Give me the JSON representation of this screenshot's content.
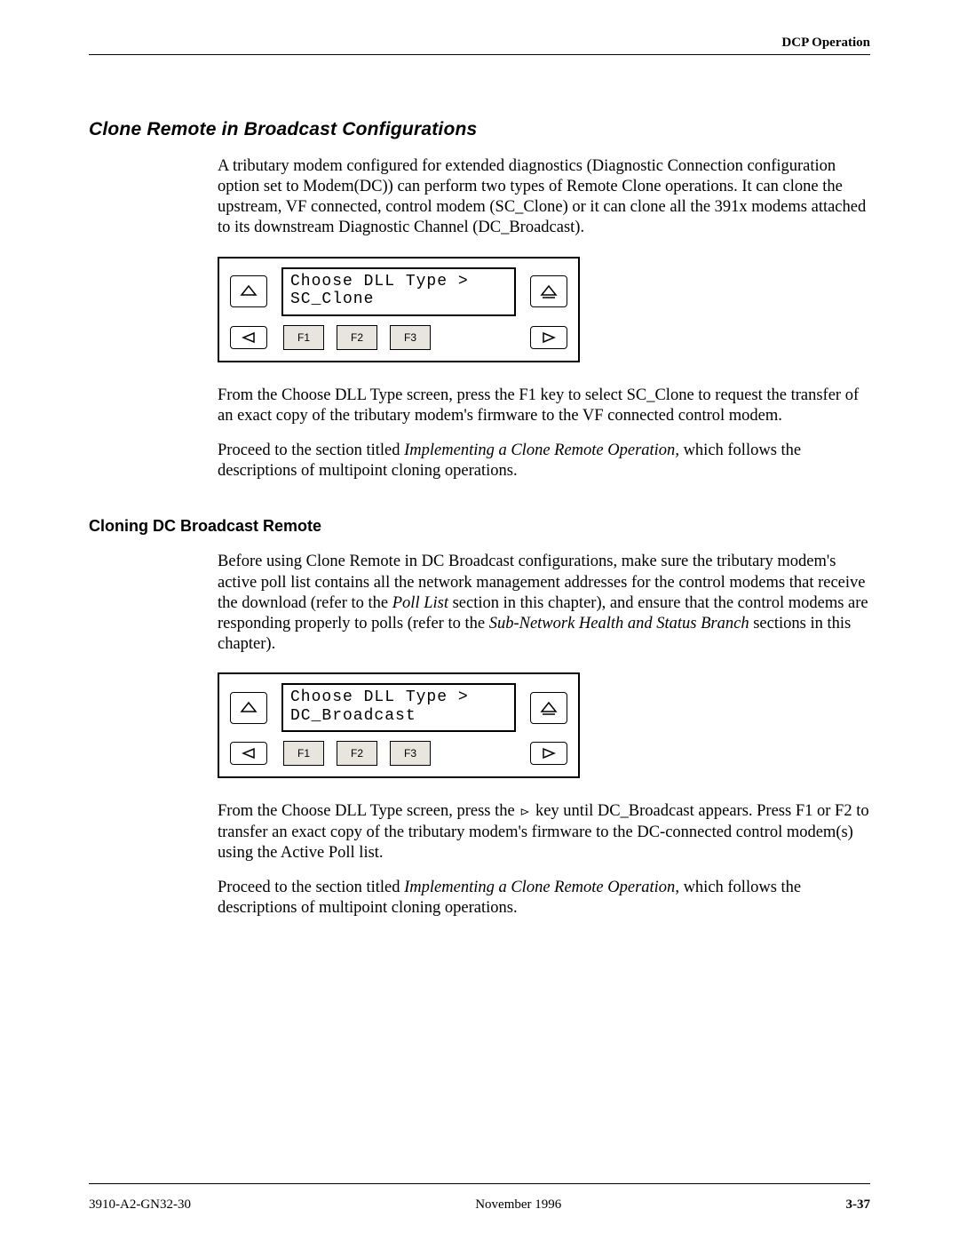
{
  "header": {
    "running": "DCP Operation"
  },
  "section": {
    "title": "Clone Remote in Broadcast Configurations",
    "p1": "A tributary modem configured for extended diagnostics (Diagnostic Connection configuration option set to Modem(DC)) can perform two types of Remote Clone operations. It can clone the upstream, VF connected, control modem (SC_Clone) or it can clone all the 391x modems attached to its downstream Diagnostic Channel (DC_Broadcast).",
    "p2": "From the Choose DLL Type screen, press the F1 key to select SC_Clone to request the transfer of an exact copy of the tributary modem's firmware to the VF connected control modem.",
    "p3_a": "Proceed to the section titled ",
    "p3_i": "Implementing a Clone Remote Operation",
    "p3_b": ", which follows the descriptions of multipoint cloning operations."
  },
  "sub": {
    "title": "Cloning DC Broadcast Remote",
    "p1_a": "Before using Clone Remote in DC Broadcast configurations, make sure the tributary modem's active poll list contains all the network management addresses for the control modems that receive the download (refer to the ",
    "p1_i1": "Poll List",
    "p1_b": " section in this chapter), and ensure that the control modems are responding properly to polls (refer to the ",
    "p1_i2": "Sub-Network Health and Status Branch",
    "p1_c": " sections in this chapter).",
    "p2_a": "From the Choose DLL Type screen, press the  ",
    "p2_b": "  key until DC_Broadcast appears. Press F1 or F2 to transfer an exact copy of the tributary modem's firmware to the DC-connected control modem(s) using the Active Poll list.",
    "p3_a": "Proceed to the section titled ",
    "p3_i": "Implementing a Clone Remote Operation",
    "p3_b": ", which follows the descriptions of multipoint cloning operations."
  },
  "panel1": {
    "line1": "Choose DLL Type >",
    "line2": "SC_Clone",
    "f1": "F1",
    "f2": "F2",
    "f3": "F3"
  },
  "panel2": {
    "line1": "Choose DLL Type >",
    "line2": "DC_Broadcast",
    "f1": "F1",
    "f2": "F2",
    "f3": "F3"
  },
  "footer": {
    "left": "3910-A2-GN32-30",
    "center": "November 1996",
    "right": "3-37"
  }
}
